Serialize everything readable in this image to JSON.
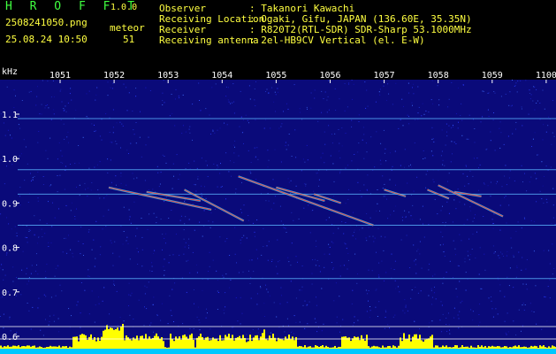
{
  "header": {
    "app_name": "H R O F F T",
    "version": "1.0.0",
    "file_name": "2508241050.png",
    "date_time": "25.08.24 10:50",
    "meteor_label": "meteor",
    "meteor_count": "51",
    "info": [
      {
        "label": "Observer",
        "value": ": Takanori Kawachi"
      },
      {
        "label": "Receiving Location",
        "value": ": Ogaki, Gifu, JAPAN (136.60E, 35.35N)"
      },
      {
        "label": "Receiver",
        "value": ": R820T2(RTL-SDR) SDR-Sharp 53.1000MHz"
      },
      {
        "label": "Receiving antenna",
        "value": ": 2el-HB9CV Vertical (el. E-W)"
      }
    ]
  },
  "chart_data": {
    "type": "heatmap",
    "ylabel": "kHz",
    "x_ticks": [
      "1051",
      "1052",
      "1053",
      "1054",
      "1055",
      "1056",
      "1057",
      "1058",
      "1059",
      "1100"
    ],
    "y_ticks": [
      "1.1",
      "1.0",
      "0.9",
      "0.8",
      "0.7",
      "0.6"
    ],
    "ylim": [
      0.57,
      1.18
    ],
    "horizontal_lines_khz": [
      1.09,
      0.975,
      0.92,
      0.85,
      0.73
    ],
    "meteor_echoes": [
      {
        "start_min": 0.9,
        "end_min": 2.8,
        "khz_start": 0.935,
        "khz_end": 0.885
      },
      {
        "start_min": 1.6,
        "end_min": 2.6,
        "khz_start": 0.925,
        "khz_end": 0.905
      },
      {
        "start_min": 2.3,
        "end_min": 3.4,
        "khz_start": 0.93,
        "khz_end": 0.86
      },
      {
        "start_min": 3.3,
        "end_min": 5.8,
        "khz_start": 0.96,
        "khz_end": 0.85
      },
      {
        "start_min": 4.0,
        "end_min": 4.9,
        "khz_start": 0.935,
        "khz_end": 0.905
      },
      {
        "start_min": 4.7,
        "end_min": 5.2,
        "khz_start": 0.92,
        "khz_end": 0.9
      },
      {
        "start_min": 6.0,
        "end_min": 6.4,
        "khz_start": 0.93,
        "khz_end": 0.915
      },
      {
        "start_min": 6.8,
        "end_min": 7.2,
        "khz_start": 0.93,
        "khz_end": 0.91
      },
      {
        "start_min": 7.0,
        "end_min": 8.2,
        "khz_start": 0.94,
        "khz_end": 0.87
      },
      {
        "start_min": 7.3,
        "end_min": 7.8,
        "khz_start": 0.925,
        "khz_end": 0.915
      }
    ],
    "colors": {
      "background": "#0a0a7a",
      "line": "#5ab4ff",
      "echo": "#ff3c3c",
      "echo_glow": "#40e0ff",
      "activity": "#ffff00",
      "baseline": "#00c8ff"
    }
  }
}
